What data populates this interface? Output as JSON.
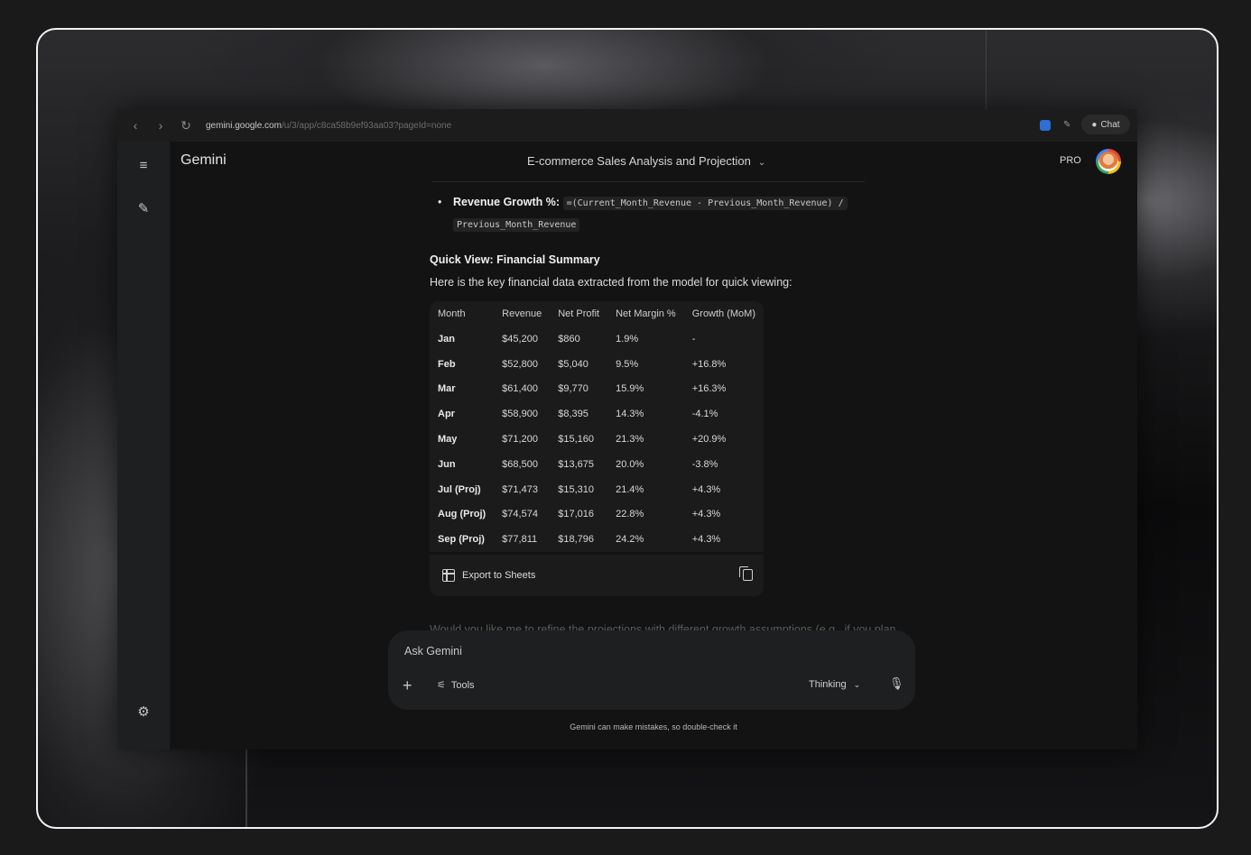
{
  "browser": {
    "url_host": "gemini.google.com",
    "url_path": "/u/3/app/c8ca58b9ef93aa03?pageId=none",
    "chat_label": "Chat"
  },
  "app": {
    "brand": "Gemini",
    "conversation_title": "E-commerce Sales Analysis and Projection",
    "pro_badge": "PRO"
  },
  "message": {
    "bullet_label": "Revenue Growth %:",
    "formula_1": "=(Current_Month_Revenue - Previous_Month_Revenue) /",
    "formula_2": "Previous_Month_Revenue",
    "heading": "Quick View: Financial Summary",
    "intro": "Here is the key financial data extracted from the model for quick viewing:",
    "table": {
      "headers": [
        "Month",
        "Revenue",
        "Net Profit",
        "Net Margin %",
        "Growth (MoM)"
      ],
      "rows": [
        [
          "Jan",
          "$45,200",
          "$860",
          "1.9%",
          "-"
        ],
        [
          "Feb",
          "$52,800",
          "$5,040",
          "9.5%",
          "+16.8%"
        ],
        [
          "Mar",
          "$61,400",
          "$9,770",
          "15.9%",
          "+16.3%"
        ],
        [
          "Apr",
          "$58,900",
          "$8,395",
          "14.3%",
          "-4.1%"
        ],
        [
          "May",
          "$71,200",
          "$15,160",
          "21.3%",
          "+20.9%"
        ],
        [
          "Jun",
          "$68,500",
          "$13,675",
          "20.0%",
          "-3.8%"
        ],
        [
          "Jul (Proj)",
          "$71,473",
          "$15,310",
          "21.4%",
          "+4.3%"
        ],
        [
          "Aug (Proj)",
          "$74,574",
          "$17,016",
          "22.8%",
          "+4.3%"
        ],
        [
          "Sep (Proj)",
          "$77,811",
          "$18,796",
          "24.2%",
          "+4.3%"
        ]
      ],
      "export_label": "Export to Sheets"
    },
    "trailing_text": "Would you like me to refine the projections with different growth assumptions (e.g., if you plan"
  },
  "composer": {
    "placeholder": "Ask Gemini",
    "tools_label": "Tools",
    "mode_label": "Thinking"
  },
  "disclaimer": "Gemini can make mistakes, so double-check it",
  "colors": {
    "background": "#131314",
    "sidebar": "#1e1f20",
    "table_bg": "#1b1b1c",
    "extension_accent": "#2d6fd6"
  },
  "icons": [
    "back-icon",
    "forward-icon",
    "reload-icon",
    "extension-icon",
    "feather-icon",
    "chat-bubble-icon",
    "menu-icon",
    "new-chat-icon",
    "settings-icon",
    "chevron-down-icon",
    "sheets-icon",
    "copy-icon",
    "plus-icon",
    "tools-icon",
    "mic-icon"
  ]
}
